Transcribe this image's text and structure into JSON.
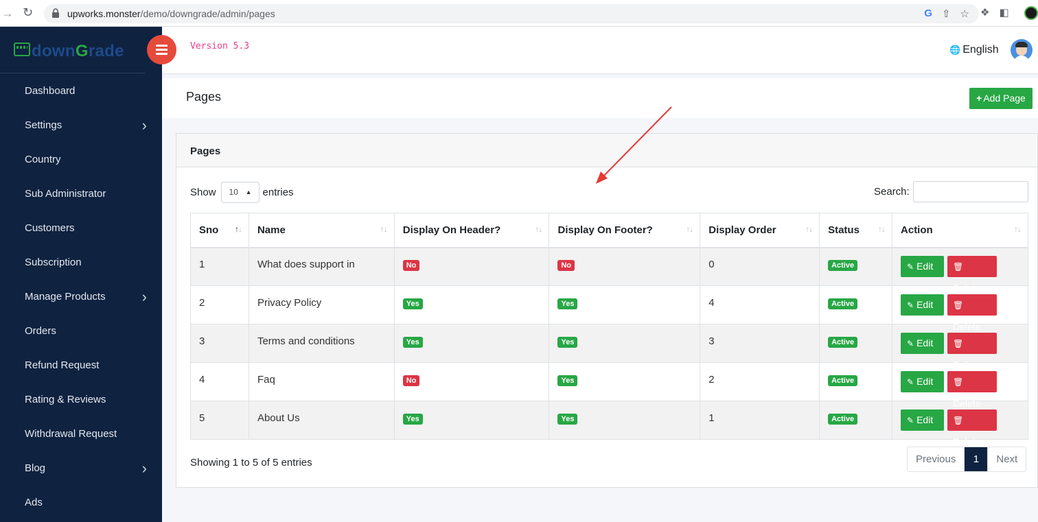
{
  "browser": {
    "url_host": "upworks.monster",
    "url_path": "/demo/downgrade/admin/pages"
  },
  "brand": {
    "name_part1": "down",
    "name_part2": "G",
    "name_part3": "rade"
  },
  "sidebar": {
    "items": [
      {
        "label": "Dashboard",
        "has_children": false
      },
      {
        "label": "Settings",
        "has_children": true
      },
      {
        "label": "Country",
        "has_children": false
      },
      {
        "label": "Sub Administrator",
        "has_children": false
      },
      {
        "label": "Customers",
        "has_children": false
      },
      {
        "label": "Subscription",
        "has_children": false
      },
      {
        "label": "Manage Products",
        "has_children": true
      },
      {
        "label": "Orders",
        "has_children": false
      },
      {
        "label": "Refund Request",
        "has_children": false
      },
      {
        "label": "Rating & Reviews",
        "has_children": false
      },
      {
        "label": "Withdrawal Request",
        "has_children": false
      },
      {
        "label": "Blog",
        "has_children": true
      },
      {
        "label": "Ads",
        "has_children": false
      }
    ]
  },
  "header": {
    "version": "Version 5.3",
    "language": "English"
  },
  "page": {
    "title": "Pages",
    "add_button": "Add Page"
  },
  "card": {
    "title": "Pages",
    "show_label": "Show",
    "entries_label": "entries",
    "page_length": "10",
    "search_label": "Search:",
    "search_value": ""
  },
  "table": {
    "columns": [
      "Sno",
      "Name",
      "Display On Header?",
      "Display On Footer?",
      "Display Order",
      "Status",
      "Action"
    ],
    "rows": [
      {
        "sno": "1",
        "name": "What does support in",
        "header": "No",
        "footer": "No",
        "order": "0",
        "status": "Active"
      },
      {
        "sno": "2",
        "name": "Privacy Policy",
        "header": "Yes",
        "footer": "Yes",
        "order": "4",
        "status": "Active"
      },
      {
        "sno": "3",
        "name": "Terms and conditions",
        "header": "Yes",
        "footer": "Yes",
        "order": "3",
        "status": "Active"
      },
      {
        "sno": "4",
        "name": "Faq",
        "header": "No",
        "footer": "Yes",
        "order": "2",
        "status": "Active"
      },
      {
        "sno": "5",
        "name": "About Us",
        "header": "Yes",
        "footer": "Yes",
        "order": "1",
        "status": "Active"
      }
    ],
    "edit_label": "Edit",
    "delete_label": "Delete"
  },
  "footer": {
    "info": "Showing 1 to 5 of 5 entries",
    "previous": "Previous",
    "current_page": "1",
    "next": "Next"
  },
  "colors": {
    "sidebar_bg": "#0f2240",
    "success": "#28a745",
    "danger": "#dc3545",
    "toggle": "#e64a3b",
    "version_text": "#e83e8c",
    "annotation": "#e53935"
  },
  "icons": {
    "nav_forward": "arrow-right-icon",
    "reload": "reload-icon",
    "lock": "lock-icon",
    "google": "google-icon",
    "share": "share-icon",
    "bookmark": "star-icon",
    "extensions": "puzzle-icon",
    "sidepanel": "sidepanel-icon",
    "menu_toggle": "bars-icon",
    "language": "language-icon",
    "add": "plus-icon",
    "edit": "edit-icon",
    "delete": "trash-icon",
    "sort": "sort-icon",
    "chevron": "chevron-right-icon"
  }
}
